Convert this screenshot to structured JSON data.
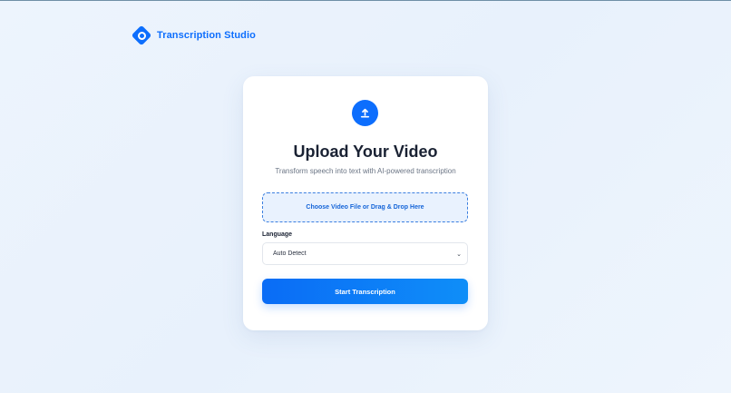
{
  "app": {
    "brand_name": "Transcription Studio",
    "accent_color": "#0d6efd"
  },
  "upload_card": {
    "icon": "upload-icon",
    "title": "Upload Your Video",
    "subtitle": "Transform speech into text with AI-powered transcription",
    "dropzone_label": "Choose Video File or Drag & Drop Here",
    "language_label": "Language",
    "language_selected": "Auto Detect",
    "submit_label": "Start Transcription"
  }
}
